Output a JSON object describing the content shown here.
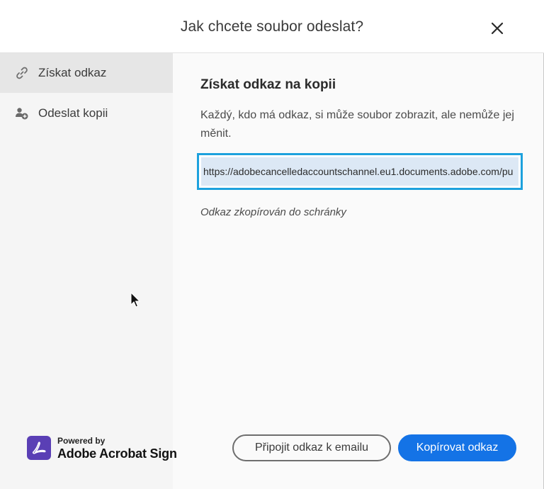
{
  "dialog": {
    "title": "Jak chcete soubor odeslat?"
  },
  "sidebar": {
    "items": [
      {
        "label": "Získat odkaz",
        "icon": "link-icon",
        "active": true
      },
      {
        "label": "Odeslat kopii",
        "icon": "add-user-icon",
        "active": false
      }
    ]
  },
  "main": {
    "title": "Získat odkaz na kopii",
    "description": "Každý, kdo má odkaz, si může soubor zobrazit, ale nemůže jej měnit.",
    "url": "https://adobecancelledaccountschannel.eu1.documents.adobe.com/pu",
    "copied_note": "Odkaz zkopírován do schránky"
  },
  "brand": {
    "powered_by": "Powered by",
    "name": "Adobe Acrobat Sign",
    "logo_color": "#5a3fb5"
  },
  "buttons": {
    "attach_email": "Připojit odkaz k emailu",
    "copy_link": "Kopírovat odkaz"
  },
  "colors": {
    "accent": "#1473e6",
    "focus_border": "#1da1dd"
  }
}
